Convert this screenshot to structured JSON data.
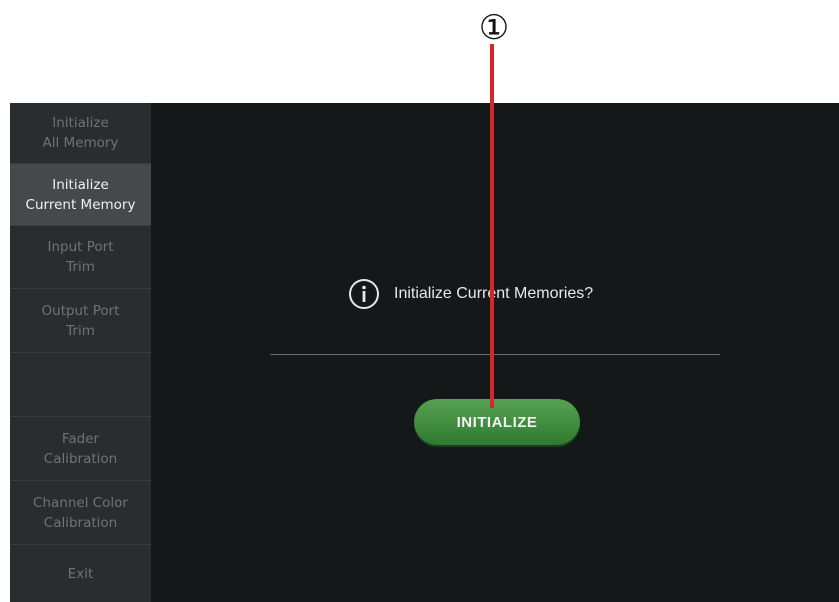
{
  "callout": {
    "number": "①"
  },
  "sidebar": {
    "items": [
      {
        "label": "Initialize\nAll Memory",
        "selected": false
      },
      {
        "label": "Initialize\nCurrent Memory",
        "selected": true
      },
      {
        "label": "Input Port\nTrim",
        "selected": false
      },
      {
        "label": "Output Port\nTrim",
        "selected": false
      },
      {
        "label": "",
        "selected": false
      },
      {
        "label": "Fader\nCalibration",
        "selected": false
      },
      {
        "label": "Channel Color\nCalibration",
        "selected": false
      },
      {
        "label": "Exit",
        "selected": false
      }
    ]
  },
  "dialog": {
    "icon": "info-icon",
    "message": "Initialize Current Memories?",
    "button_label": "INITIALIZE"
  },
  "colors": {
    "button_green": "#3f8c3c",
    "callout_line": "#d6252b",
    "selected_item": "#46494c"
  }
}
